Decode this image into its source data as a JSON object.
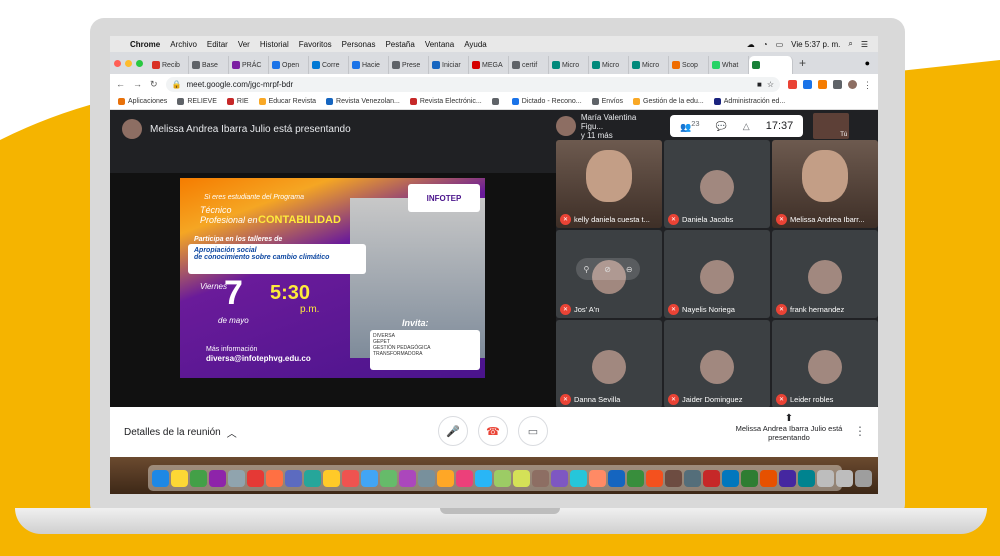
{
  "menubar": {
    "app": "Chrome",
    "items": [
      "Archivo",
      "Editar",
      "Ver",
      "Historial",
      "Favoritos",
      "Personas",
      "Pestaña",
      "Ventana",
      "Ayuda"
    ],
    "clock": "Vie 5:37 p. m."
  },
  "tabs": [
    {
      "label": "Recib",
      "color": "#d93025"
    },
    {
      "label": "Base",
      "color": "#5f6368"
    },
    {
      "label": "PRÁC",
      "color": "#7b1fa2"
    },
    {
      "label": "Open",
      "color": "#1a73e8"
    },
    {
      "label": "Corre",
      "color": "#0078d4"
    },
    {
      "label": "Hacie",
      "color": "#1a73e8"
    },
    {
      "label": "Prese",
      "color": "#5f6368"
    },
    {
      "label": "Iniciar",
      "color": "#1565c0"
    },
    {
      "label": "MEGA",
      "color": "#d50000"
    },
    {
      "label": "certif",
      "color": "#5f6368"
    },
    {
      "label": "Micro",
      "color": "#00897b"
    },
    {
      "label": "Micro",
      "color": "#00897b"
    },
    {
      "label": "Micro",
      "color": "#00897b"
    },
    {
      "label": "Scop",
      "color": "#ef6c00"
    },
    {
      "label": "What",
      "color": "#25d366"
    },
    {
      "label": "",
      "color": "#188038"
    }
  ],
  "address": {
    "url": "meet.google.com/jgc-mrpf-bdr"
  },
  "bookmarks": [
    {
      "label": "Aplicaciones",
      "color": "#e8710a"
    },
    {
      "label": "RELIEVE",
      "color": "#5f6368"
    },
    {
      "label": "RIE",
      "color": "#c62828"
    },
    {
      "label": "Educar Revista",
      "color": "#f9a825"
    },
    {
      "label": "Revista Venezolan...",
      "color": "#1565c0"
    },
    {
      "label": "Revista Electrónic...",
      "color": "#c62828"
    },
    {
      "label": "",
      "color": "#5f6368"
    },
    {
      "label": "Dictado - Recono...",
      "color": "#1a73e8"
    },
    {
      "label": "Envíos",
      "color": "#5f6368"
    },
    {
      "label": "Gestión de la edu...",
      "color": "#f9a825"
    },
    {
      "label": "Administración ed...",
      "color": "#1a237e"
    }
  ],
  "meet": {
    "presenting_banner": "Melissa Andrea Ibarra Julio está presentando",
    "top_speaker": "María Valentina Figu...",
    "top_speaker_more": "y 11 más",
    "people_count": "23",
    "time": "17:37",
    "self_label": "Tú",
    "participants": [
      {
        "name": "kelly daniela cuesta t...",
        "video": true
      },
      {
        "name": "Daniela Jacobs",
        "video": false
      },
      {
        "name": "Melissa Andrea Ibarr...",
        "video": true
      },
      {
        "name": "Jos' A'n",
        "video": false
      },
      {
        "name": "Nayelis Noriega",
        "video": false
      },
      {
        "name": "frank hernandez",
        "video": false
      },
      {
        "name": "Danna Sevilla",
        "video": false
      },
      {
        "name": "Jaider Dominguez",
        "video": false
      },
      {
        "name": "Leider robles",
        "video": false
      }
    ],
    "details_label": "Detalles de la reunión",
    "presenting_footer": "Melissa Andrea Ibarra Julio está presentando"
  },
  "slide": {
    "line1": "Si eres estudiante del Programa",
    "line2": "Técnico",
    "line3": "Profesional en",
    "line3b": "CONTABILIDAD",
    "line4": "Participa en los talleres de",
    "banner1": "Apropiación social",
    "banner2": "de conocimiento sobre cambio climático",
    "day": "Viernes",
    "date_num": "7",
    "month": "de mayo",
    "time": "5:30",
    "pm": "p.m.",
    "more_info": "Más información",
    "email": "diversa@infotephvg.edu.co",
    "invite": "Invita:",
    "logo": "INFOTEP",
    "partner1": "DIVERSA",
    "partner2": "GEPET",
    "partner3": "GESTIÓN PEDAGÓGICA TRANSFORMADORA"
  }
}
